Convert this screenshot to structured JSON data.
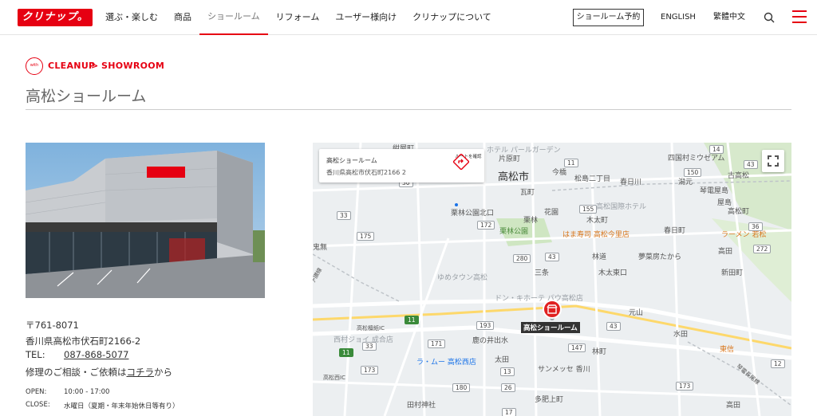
{
  "header": {
    "logo_text": "クリナップ。",
    "nav": [
      "選ぶ・楽しむ",
      "商品",
      "ショールーム",
      "リフォーム",
      "ユーザー様向け",
      "クリナップについて"
    ],
    "showroom_reserve": "ショールーム予約",
    "lang_en": "ENGLISH",
    "lang_zh": "繁體中文"
  },
  "breadcrumb": {
    "badge": "with",
    "item1": "CLEANUP",
    "sep": ">",
    "item2": "SHOWROOM"
  },
  "page_title": "高松ショールーム",
  "info": {
    "postal": "〒761-8071",
    "address": "香川県高松市伏石町2166-2",
    "tel_label": "TEL:",
    "tel": "087-868-5077",
    "repair_pre": "修理のご相談・ご依頼は",
    "repair_link": "コチラ",
    "repair_post": "から",
    "open_label": "OPEN:",
    "open_value": "10:00 - 17:00",
    "close_label": "CLOSE:",
    "close_value": "水曜日（夏期・年末年始休日等有り）"
  },
  "map": {
    "infobox_title": "高松ショールーム",
    "infobox_address": "香川県高松市伏石町2166 2",
    "route_label": "ルートを確認",
    "pin_label": "高松ショールーム",
    "labels": {
      "l1": "紺屋町",
      "l2": "ホテル パールガーデン",
      "l3": "四国村ミウゼアム",
      "l4": "高松市",
      "l5": "片原町",
      "l6": "今橋",
      "l7": "松島二丁目",
      "l8": "春日川",
      "l9": "潟元",
      "l10": "古高松",
      "l11": "瓦町",
      "l12": "琴電屋島",
      "l13": "屋島",
      "l14": "花園",
      "l15": "高松国際ホテル",
      "l16": "栗林公園北口",
      "l17": "栗林",
      "l18": "木太町",
      "l19": "高松町",
      "l20": "栗林公園",
      "l21": "はま寿司 高松今里店",
      "l22": "春日町",
      "l23": "ラーメン 若松",
      "l24": "鬼無",
      "l25": "林道",
      "l26": "夢菜房たから",
      "l27": "高田",
      "l28": "三条",
      "l29": "木太東口",
      "l30": "新田町",
      "l31": "ゆめタウン高松",
      "l32": "ドン・キホーテ パウ高松店",
      "l33": "元山",
      "l34": "高松檀紙IC",
      "l35": "水田",
      "l36": "西村ジョイ 成合店",
      "l37": "鹿の井出水",
      "l38": "林町",
      "l39": "東信",
      "l40": "太田",
      "l41": "ラ・ムー 高松西店",
      "l42": "高松西IC",
      "l43": "サンメッセ 香川",
      "l44": "多肥上町",
      "l45": "田村神社",
      "l46": "高田",
      "l47": "香川",
      "l48": "予讃線",
      "l49": "琴電長尾線"
    },
    "shields": [
      "30",
      "11",
      "150",
      "43",
      "155",
      "33",
      "175",
      "172",
      "36",
      "272",
      "280",
      "43",
      "11",
      "193",
      "171",
      "147",
      "33",
      "11",
      "173",
      "13",
      "26",
      "180",
      "14",
      "43",
      "173",
      "12",
      "17"
    ],
    "colors": {
      "accent": "#e60012",
      "map_bg": "#eceff1",
      "park": "#cfe6c2",
      "road": "#ffffff"
    }
  }
}
